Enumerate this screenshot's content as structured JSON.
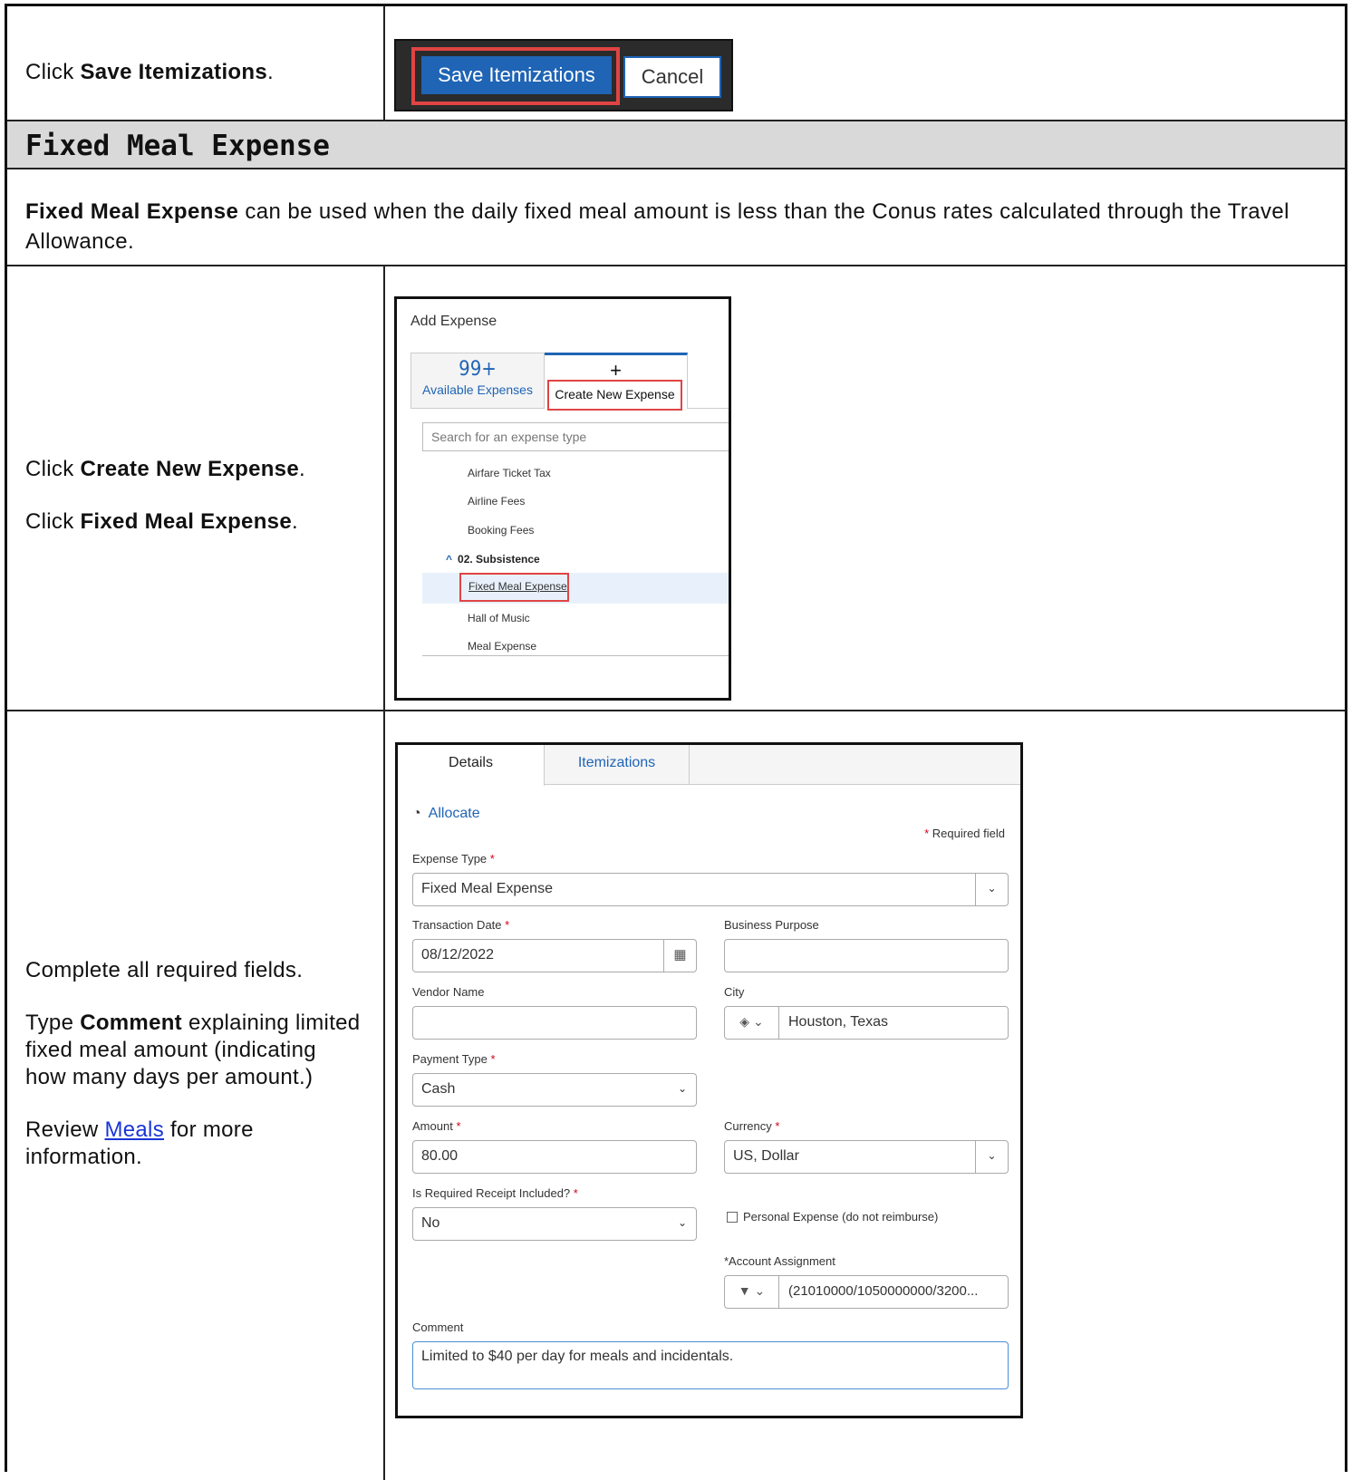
{
  "rows": {
    "save": {
      "instruction_prefix": "Click ",
      "instruction_bold": "Save Itemizations",
      "instruction_suffix": ".",
      "screenshot": {
        "save_label": "Save Itemizations",
        "cancel_label": "Cancel"
      }
    },
    "section": {
      "title": "Fixed Meal Expense",
      "intro_bold": "Fixed Meal Expense",
      "intro_text": " can be used when the daily fixed meal amount is less than the Conus rates calculated through the Travel Allowance."
    },
    "create": {
      "line1_prefix": "Click ",
      "line1_bold": "Create New Expense",
      "line1_suffix": ".",
      "line2_prefix": "Click ",
      "line2_bold": "Fixed Meal Expense",
      "line2_suffix": ".",
      "screenshot": {
        "title": "Add Expense",
        "available_count": "99+",
        "available_label": "Available Expenses",
        "create_plus": "+",
        "create_label": "Create New Expense",
        "search_placeholder": "Search for an expense type",
        "items": [
          "Airfare Ticket Tax",
          "Airline Fees",
          "Booking Fees"
        ],
        "group_label": "02. Subsistence",
        "selected_item": "Fixed Meal Expense",
        "items_after": [
          "Hall of Music",
          "Meal Expense"
        ]
      }
    },
    "complete": {
      "line1": "Complete all required fields.",
      "line2_prefix": "Type ",
      "line2_bold": "Comment",
      "line2_suffix": " explaining limited fixed meal amount (indicating how many days per amount.)",
      "line3_prefix": "Review ",
      "line3_link": "Meals",
      "line3_suffix": " for more information.",
      "screenshot": {
        "tab_details": "Details",
        "tab_itemizations": "Itemizations",
        "allocate_label": "Allocate",
        "required_note": "Required field",
        "expense_type_label": "Expense Type",
        "expense_type_value": "Fixed Meal Expense",
        "transaction_date_label": "Transaction Date",
        "transaction_date_value": "08/12/2022",
        "business_purpose_label": "Business Purpose",
        "business_purpose_value": "",
        "vendor_name_label": "Vendor Name",
        "vendor_name_value": "",
        "city_label": "City",
        "city_value": "Houston, Texas",
        "payment_type_label": "Payment Type",
        "payment_type_value": "Cash",
        "amount_label": "Amount",
        "amount_value": "80.00",
        "currency_label": "Currency",
        "currency_value": "US, Dollar",
        "receipt_label": "Is Required Receipt Included?",
        "receipt_value": "No",
        "personal_expense_label": "Personal Expense (do not reimburse)",
        "account_label": "*Account Assignment",
        "account_value": "(21010000/1050000000/3200...",
        "comment_label": "Comment",
        "comment_value": "Limited to $40 per day for meals and incidentals."
      }
    }
  },
  "colors": {
    "accent": "#1f64b5",
    "highlight": "#e04444",
    "header_bg": "#d9d9d9",
    "link": "#1a35d6"
  }
}
